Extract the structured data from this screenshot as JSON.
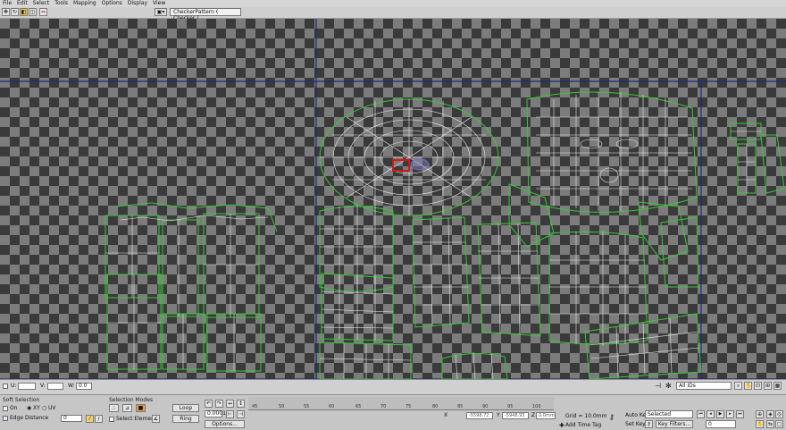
{
  "menu": [
    "File",
    "Edit",
    "Select",
    "Tools",
    "Mapping",
    "Options",
    "Display",
    "View"
  ],
  "toolbar": {
    "texture_dropdown": "CheckerPattern ( Checker )",
    "tools": [
      "move-tool",
      "rotate-tool",
      "scale-tool",
      "freeform-tool",
      "mirror-tool"
    ]
  },
  "viewport": {
    "status": {
      "u_label": "U:",
      "v_label": "V:",
      "w_label": "W:",
      "w_value": "0.0",
      "ids_dropdown": "All IDs"
    }
  },
  "soft_selection": {
    "title": "Soft Selection",
    "on_label": "On",
    "xy_label": "XY",
    "uv_label": "UV",
    "edge_distance_label": "Edge Distance",
    "falloff_value": "0"
  },
  "selection_modes": {
    "title": "Selection Modes",
    "select_element_label": "Select Element",
    "loop_label": "Loop",
    "ring_label": "Ring",
    "options_label": "Options...",
    "threshold_value": "0.0001"
  },
  "timeline": {
    "ticks": [
      "45",
      "50",
      "55",
      "60",
      "65",
      "70",
      "75",
      "80",
      "85",
      "90",
      "95",
      "100"
    ]
  },
  "coords": {
    "x": "-5598.72",
    "y": "-5948.93",
    "z": "0.0mm"
  },
  "grid_label": "Grid = 10.0mm",
  "add_time_tag": "Add Time Tag",
  "auto_key_label": "Auto Key",
  "auto_key_value": "Selected",
  "set_key_label": "Set Key",
  "key_filters_label": "Key Filters...",
  "frame_value": "0",
  "colors": {
    "uv_edge": "#e8e8e8",
    "uv_border": "#39c739",
    "region_frame": "#1f2a78",
    "selected_face": "#d01818"
  }
}
